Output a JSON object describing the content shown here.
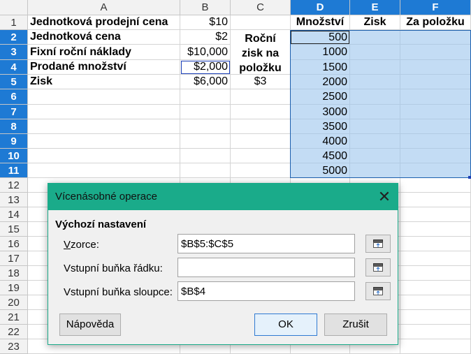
{
  "columns": [
    "A",
    "B",
    "C",
    "D",
    "E",
    "F"
  ],
  "rows": [
    "1",
    "2",
    "3",
    "4",
    "5",
    "6",
    "7",
    "8",
    "9",
    "10",
    "11",
    "12",
    "13",
    "14",
    "15",
    "16",
    "17",
    "18",
    "19",
    "20",
    "21",
    "22",
    "23"
  ],
  "cells": {
    "A1": "Jednotková prodejní cena",
    "B1": "$10",
    "A2": "Jednotková cena",
    "B2": "$2",
    "A3": "Fixní roční náklady",
    "B3": "$10,000",
    "A4": "Prodané množství",
    "B4": "$2,000",
    "A5": "Zisk",
    "B5": "$6,000",
    "C2_line1": "Roční",
    "C2_line2": "zisk na",
    "C2_line3": "položku",
    "C5": "$3",
    "D1": "Množství",
    "E1": "Zisk",
    "F1": "Za položku",
    "D_values": [
      "500",
      "1000",
      "1500",
      "2000",
      "2500",
      "3000",
      "3500",
      "4000",
      "4500",
      "5000"
    ]
  },
  "dialog": {
    "title": "Vícenásobné operace",
    "close_glyph": "✕",
    "section": "Výchozí nastavení",
    "formulas_label": "Vzorce:",
    "formulas_value": "$B$5:$C$5",
    "row_input_label": "Vstupní buňka řádku:",
    "row_input_value": "",
    "col_input_label": "Vstupní buňka sloupce:",
    "col_input_value": "$B$4",
    "help_button": "Nápověda",
    "ok_button": "OK",
    "cancel_button": "Zrušit"
  },
  "colors": {
    "selection_header": "#1e7ad4",
    "selection_fill": "#c3dcf4",
    "dialog_title": "#1aab8a"
  },
  "icons": [
    "shrink-icon"
  ]
}
